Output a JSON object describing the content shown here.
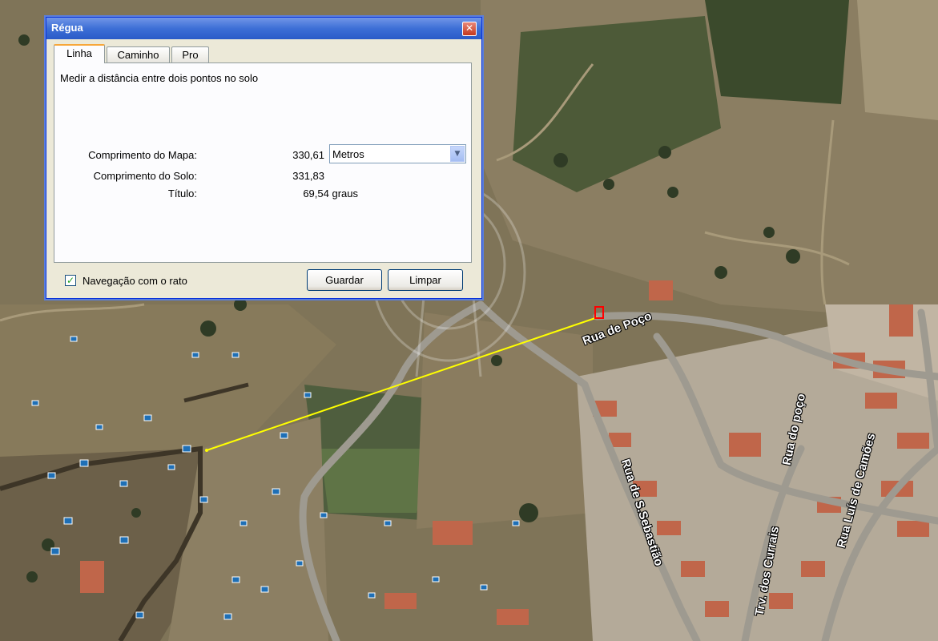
{
  "dialog": {
    "title": "Régua",
    "close_glyph": "✕",
    "tabs": [
      {
        "label": "Linha",
        "active": true
      },
      {
        "label": "Caminho",
        "active": false
      },
      {
        "label": "Pro",
        "active": false
      }
    ],
    "description": "Medir a distância entre dois pontos no solo",
    "map_length_label": "Comprimento do Mapa:",
    "map_length_value": "330,61",
    "ground_length_label": "Comprimento do Solo:",
    "ground_length_value": "331,83",
    "heading_label": "Título:",
    "heading_value": "69,54 graus",
    "units_selected": "Metros",
    "mouse_nav_label": "Navegação com o rato",
    "mouse_nav_checked": true,
    "save_label": "Guardar",
    "clear_label": "Limpar"
  },
  "map": {
    "streets": [
      "Rua de Poço",
      "Rua de S.Sebastião",
      "Trv. dos Currais",
      "Rua do poço",
      "Rua Luís de Camões"
    ],
    "measure_line_color": "#ffff00",
    "marker_color": "#ff0000"
  }
}
